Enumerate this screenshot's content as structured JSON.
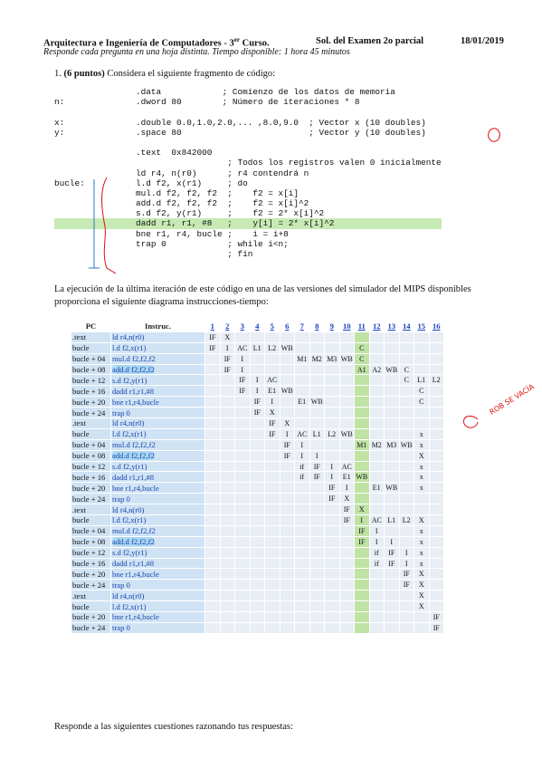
{
  "header": {
    "course": "Arquitectura e Ingeniería de Computadores - 3",
    "course_sup": "er",
    "course_end": " Curso.",
    "exam": "Sol. del Examen 2o parcial",
    "date": "18/01/2019",
    "subtitle": "Responde cada pregunta en una hoja distinta. Tiempo disponible: 1 hora 45 minutos"
  },
  "question": {
    "number": "1.",
    "points": "(6 puntos)",
    "text": " Considera el siguiente fragmento de código:"
  },
  "code_lines": [
    "                .data            ; Comienzo de los datos de memoria",
    "n:              .dword 80        ; Número de iteraciones * 8",
    "",
    "x:              .double 0.0,1.0,2.0,... ,8.0,9.0  ; Vector x (10 doubles)",
    "y:              .space 80                         ; Vector y (10 doubles)",
    "",
    "                .text  0x842000",
    "                                  ; Todos los registros valen 0 inicialmente",
    "                ld r4, n(r0)      ; r4 contendrá n",
    "bucle:          l.d f2, x(r1)     ; do",
    "                mul.d f2, f2, f2  ;    f2 = x[i]",
    "                add.d f2, f2, f2  ;    f2 = x[i]^2",
    "                s.d f2, y(r1)     ;    f2 = 2* x[i]^2",
    "                dadd r1, r1, #8   ;    y[i] = 2* x[i]^2",
    "                bne r1, r4, bucle ;    i = i+8",
    "                trap 0            ; while i<n;",
    "                                  ; fin"
  ],
  "paragraph": "La ejecución de la última iteración de este código en una de las versiones del simulador del MIPS disponibles proporciona el siguiente diagrama instrucciones-tiempo:",
  "table": {
    "head_pc": "PC",
    "head_instr": "Instruc.",
    "cycles": [
      "1",
      "2",
      "3",
      "4",
      "5",
      "6",
      "7",
      "8",
      "9",
      "10",
      "11",
      "12",
      "13",
      "14",
      "15",
      "16"
    ],
    "rows": [
      {
        "pc": ".text",
        "instr": "ld r4,n(r0)",
        "cells": [
          "IF",
          "X",
          "",
          "",
          "",
          "",
          "",
          "",
          "",
          "",
          "",
          "",
          "",
          "",
          "",
          ""
        ]
      },
      {
        "pc": "bucle",
        "instr": "l.d f2,x(r1)",
        "cells": [
          "IF",
          "I",
          "AC",
          "L1",
          "L2",
          "WB",
          "",
          "",
          "",
          "",
          "C",
          "",
          "",
          "",
          "",
          ""
        ]
      },
      {
        "pc": "bucle + 04",
        "instr": "mul.d f2,f2,f2",
        "cells": [
          "",
          "IF",
          "I",
          "",
          "",
          "",
          "M1",
          "M2",
          "M3",
          "WB",
          "C",
          "",
          "",
          "",
          "",
          ""
        ]
      },
      {
        "pc": "bucle + 08",
        "instr": "add.d f2,f2,f2",
        "cells": [
          "",
          "IF",
          "I",
          "",
          "",
          "",
          "",
          "",
          "",
          "",
          "A1",
          "A2",
          "WB",
          "C",
          "",
          ""
        ]
      },
      {
        "pc": "bucle + 12",
        "instr": "s.d f2,y(r1)",
        "cells": [
          "",
          "",
          "IF",
          "I",
          "AC",
          "",
          "",
          "",
          "",
          "",
          "",
          "",
          "",
          "C",
          "L1",
          "L2"
        ]
      },
      {
        "pc": "bucle + 16",
        "instr": "dadd r1,r1,#8",
        "cells": [
          "",
          "",
          "IF",
          "I",
          "E1",
          "WB",
          "",
          "",
          "",
          "",
          "",
          "",
          "",
          "",
          "C",
          ""
        ]
      },
      {
        "pc": "bucle + 20",
        "instr": "bne r1,r4,bucle",
        "cells": [
          "",
          "",
          "",
          "IF",
          "I",
          "",
          "E1",
          "WB",
          "",
          "",
          "",
          "",
          "",
          "",
          "C",
          ""
        ]
      },
      {
        "pc": "bucle + 24",
        "instr": "trap 0",
        "cells": [
          "",
          "",
          "",
          "IF",
          "X",
          "",
          "",
          "",
          "",
          "",
          "",
          "",
          "",
          "",
          "",
          ""
        ]
      },
      {
        "pc": ".text",
        "instr": "ld r4,n(r0)",
        "cells": [
          "",
          "",
          "",
          "",
          "IF",
          "X",
          "",
          "",
          "",
          "",
          "",
          "",
          "",
          "",
          "",
          ""
        ]
      },
      {
        "pc": "bucle",
        "instr": "l.d f2,x(r1)",
        "cells": [
          "",
          "",
          "",
          "",
          "IF",
          "I",
          "AC",
          "L1",
          "L2",
          "WB",
          "",
          "",
          "",
          "",
          "x",
          ""
        ]
      },
      {
        "pc": "bucle + 04",
        "instr": "mul.d f2,f2,f2",
        "cells": [
          "",
          "",
          "",
          "",
          "",
          "IF",
          "I",
          "",
          "",
          "",
          "M1",
          "M2",
          "M3",
          "WB",
          "x",
          ""
        ]
      },
      {
        "pc": "bucle + 08",
        "instr": "add.d f2,f2,f2",
        "cells": [
          "",
          "",
          "",
          "",
          "",
          "IF",
          "I",
          "I",
          "",
          "",
          "",
          "",
          "",
          "",
          "X",
          ""
        ]
      },
      {
        "pc": "bucle + 12",
        "instr": "s.d f2,y(r1)",
        "cells": [
          "",
          "",
          "",
          "",
          "",
          "",
          "if",
          "IF",
          "I",
          "AC",
          "",
          "",
          "",
          "",
          "x",
          ""
        ]
      },
      {
        "pc": "bucle + 16",
        "instr": "dadd r1,r1,#8",
        "cells": [
          "",
          "",
          "",
          "",
          "",
          "",
          "if",
          "IF",
          "I",
          "E1",
          "WB",
          "",
          "",
          "",
          "x",
          ""
        ]
      },
      {
        "pc": "bucle + 20",
        "instr": "bne r1,r4,bucle",
        "cells": [
          "",
          "",
          "",
          "",
          "",
          "",
          "",
          "",
          "IF",
          "I",
          "",
          "E1",
          "WB",
          "",
          "x",
          ""
        ]
      },
      {
        "pc": "bucle + 24",
        "instr": "trap 0",
        "cells": [
          "",
          "",
          "",
          "",
          "",
          "",
          "",
          "",
          "IF",
          "X",
          "",
          "",
          "",
          "",
          "",
          ""
        ]
      },
      {
        "pc": ".text",
        "instr": "ld r4,n(r0)",
        "cells": [
          "",
          "",
          "",
          "",
          "",
          "",
          "",
          "",
          "",
          "IF",
          "X",
          "",
          "",
          "",
          "",
          ""
        ]
      },
      {
        "pc": "bucle",
        "instr": "l.d f2,x(r1)",
        "cells": [
          "",
          "",
          "",
          "",
          "",
          "",
          "",
          "",
          "",
          "IF",
          "I",
          "AC",
          "L1",
          "L2",
          "X",
          ""
        ]
      },
      {
        "pc": "bucle + 04",
        "instr": "mul.d f2,f2,f2",
        "cells": [
          "",
          "",
          "",
          "",
          "",
          "",
          "",
          "",
          "",
          "",
          "IF",
          "I",
          "",
          "",
          "x",
          ""
        ]
      },
      {
        "pc": "bucle + 08",
        "instr": "add.d f2,f2,f2",
        "cells": [
          "",
          "",
          "",
          "",
          "",
          "",
          "",
          "",
          "",
          "",
          "IF",
          "I",
          "I",
          "",
          "x",
          ""
        ]
      },
      {
        "pc": "bucle + 12",
        "instr": "s.d f2,y(r1)",
        "cells": [
          "",
          "",
          "",
          "",
          "",
          "",
          "",
          "",
          "",
          "",
          "",
          "if",
          "IF",
          "I",
          "x",
          ""
        ]
      },
      {
        "pc": "bucle + 16",
        "instr": "dadd r1,r1,#8",
        "cells": [
          "",
          "",
          "",
          "",
          "",
          "",
          "",
          "",
          "",
          "",
          "",
          "if",
          "IF",
          "I",
          "x",
          ""
        ]
      },
      {
        "pc": "bucle + 20",
        "instr": "bne r1,r4,bucle",
        "cells": [
          "",
          "",
          "",
          "",
          "",
          "",
          "",
          "",
          "",
          "",
          "",
          "",
          "",
          "IF",
          "X",
          ""
        ]
      },
      {
        "pc": "bucle + 24",
        "instr": "trap 0",
        "cells": [
          "",
          "",
          "",
          "",
          "",
          "",
          "",
          "",
          "",
          "",
          "",
          "",
          "",
          "IF",
          "X",
          ""
        ]
      },
      {
        "pc": ".text",
        "instr": "ld r4,n(r0)",
        "cells": [
          "",
          "",
          "",
          "",
          "",
          "",
          "",
          "",
          "",
          "",
          "",
          "",
          "",
          "",
          "X",
          ""
        ]
      },
      {
        "pc": "bucle",
        "instr": "l.d f2,x(r1)",
        "cells": [
          "",
          "",
          "",
          "",
          "",
          "",
          "",
          "",
          "",
          "",
          "",
          "",
          "",
          "",
          "X",
          ""
        ]
      },
      {
        "pc": "bucle + 20",
        "instr": "bne r1,r4,bucle",
        "cells": [
          "",
          "",
          "",
          "",
          "",
          "",
          "",
          "",
          "",
          "",
          "",
          "",
          "",
          "",
          "",
          "IF"
        ]
      },
      {
        "pc": "bucle + 24",
        "instr": "trap 0",
        "cells": [
          "",
          "",
          "",
          "",
          "",
          "",
          "",
          "",
          "",
          "",
          "",
          "",
          "",
          "",
          "",
          "IF"
        ]
      }
    ]
  },
  "annotation": "ROB SE VACÍA",
  "footer": "Responde a las siguientes cuestiones razonando tus respuestas:",
  "colors": {
    "highlight_green": "#bfe3a5",
    "cell_bg": "#e9eef5",
    "label_bg": "#cfe3f4",
    "link_blue": "#1a3fbf",
    "pen_red": "#d11111",
    "pen_blue": "#3aa4d8"
  }
}
